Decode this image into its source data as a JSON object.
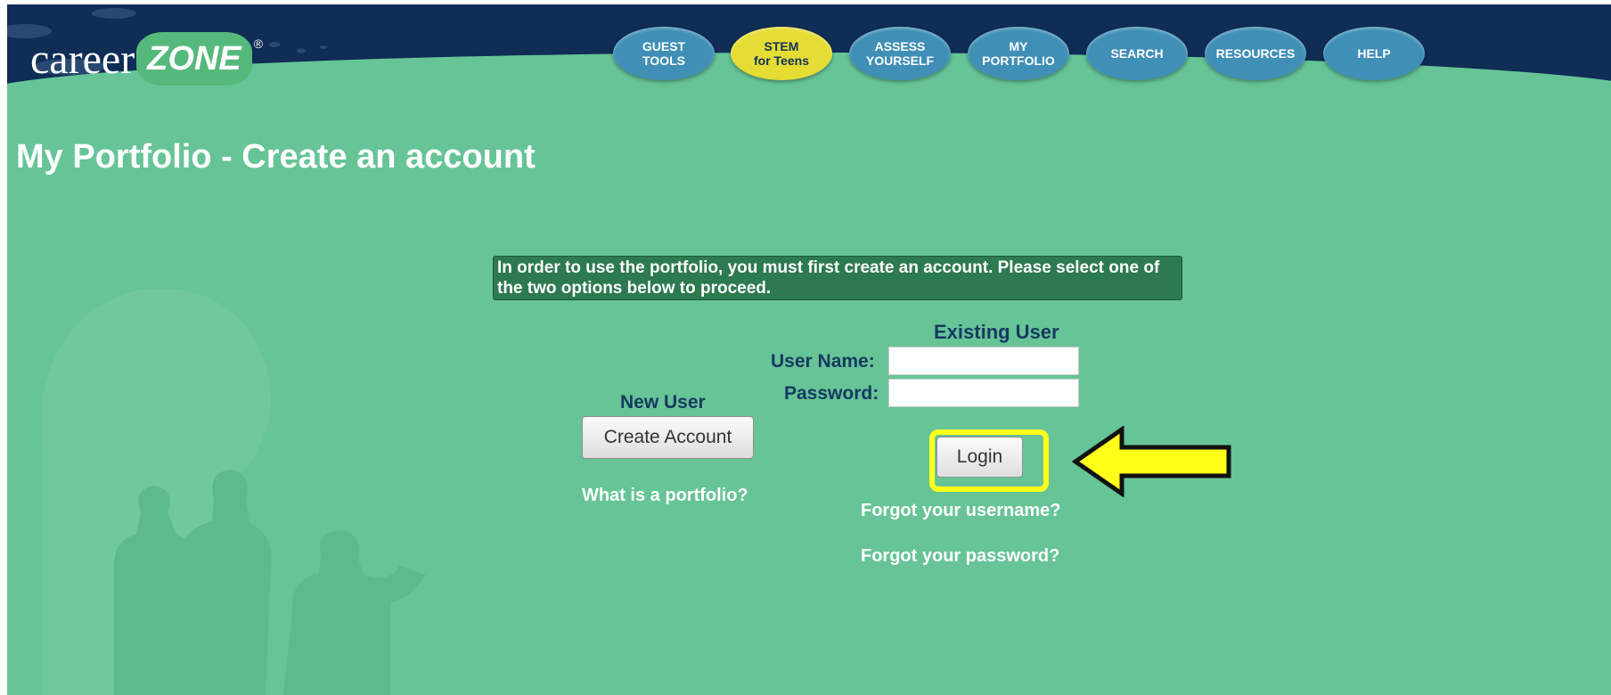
{
  "header": {
    "logo": {
      "text_main": "career",
      "text_accent": "ZONE",
      "mark": "®"
    },
    "nav": [
      {
        "id": "guest-tools",
        "label": "GUEST\nTOOLS",
        "active": false
      },
      {
        "id": "stem-for-teens",
        "label": "STEM\nfor Teens",
        "active": true
      },
      {
        "id": "assess-yourself",
        "label": "ASSESS\nYOURSELF",
        "active": false
      },
      {
        "id": "my-portfolio",
        "label": "MY\nPORTFOLIO",
        "active": false
      },
      {
        "id": "search",
        "label": "SEARCH",
        "active": false
      },
      {
        "id": "resources",
        "label": "RESOURCES",
        "active": false
      },
      {
        "id": "help",
        "label": "HELP",
        "active": false
      }
    ]
  },
  "page": {
    "title": "My Portfolio - Create an account"
  },
  "notice": "In order to use the portfolio, you must first create an account. Please select one of the two options below to proceed.",
  "new_user": {
    "heading": "New User",
    "create_button": "Create Account",
    "what_is_link": "What is a portfolio?"
  },
  "existing_user": {
    "heading": "Existing User",
    "username_label": "User Name:",
    "username_value": "",
    "password_label": "Password:",
    "password_value": "",
    "login_button": "Login",
    "forgot_username": "Forgot your username?",
    "forgot_password": "Forgot your password?"
  },
  "annotation": {
    "highlight_color": "#ffff1a",
    "arrow_direction": "left"
  },
  "colors": {
    "background": "#66c497",
    "header": "#0f2d55",
    "tab": "#3f8fb6",
    "tab_active": "#e5dc34",
    "notice": "#2d7a50",
    "label": "#163a60"
  }
}
